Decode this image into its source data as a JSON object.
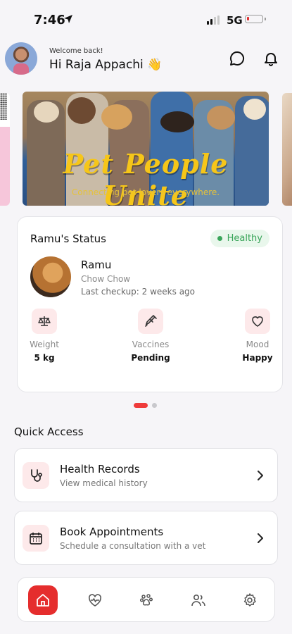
{
  "status_bar": {
    "time": "7:46",
    "network": "5G"
  },
  "header": {
    "welcome": "Welcome back!",
    "greeting": "Hi Raja Appachi 👋"
  },
  "banner": {
    "title": "Pet People Unite",
    "subtitle": "Connecting pet lovers everywhere."
  },
  "pet_status": {
    "title": "Ramu's Status",
    "badge": "Healthy",
    "name": "Ramu",
    "breed": "Chow Chow",
    "last_checkup": "Last checkup: 2 weeks ago",
    "stats": [
      {
        "label": "Weight",
        "value": "5 kg",
        "icon": "scale-icon"
      },
      {
        "label": "Vaccines",
        "value": "Pending",
        "icon": "syringe-icon"
      },
      {
        "label": "Mood",
        "value": "Happy",
        "icon": "heart-icon"
      }
    ]
  },
  "carousel": {
    "pages": 2,
    "active_index": 0
  },
  "quick_access": {
    "title": "Quick Access",
    "items": [
      {
        "title": "Health Records",
        "subtitle": "View medical history",
        "icon": "stethoscope-icon"
      },
      {
        "title": "Book Appointments",
        "subtitle": "Schedule a consultation with a vet",
        "icon": "calendar-icon"
      }
    ]
  },
  "tabbar": {
    "items": [
      "home-icon",
      "heart-pulse-icon",
      "paw-icon",
      "users-icon",
      "settings-icon"
    ],
    "active_index": 0
  },
  "colors": {
    "accent": "#e52d2d",
    "healthy": "#3aa55a",
    "icon_bg": "#fde9ea",
    "banner_text": "#f6c619"
  }
}
